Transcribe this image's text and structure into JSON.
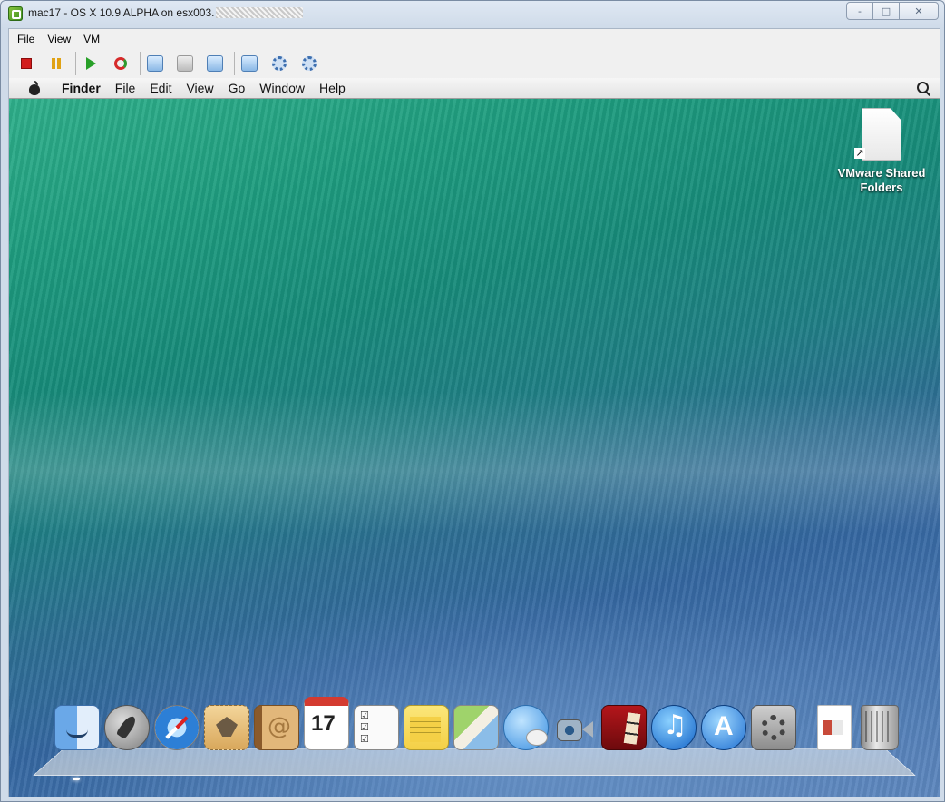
{
  "window": {
    "title": "mac17 - OS X 10.9 ALPHA on esx003.",
    "controls": [
      "-",
      "□",
      "✕"
    ]
  },
  "app_menu": [
    "File",
    "View",
    "VM"
  ],
  "toolbar": {
    "buttons": [
      "stop-icon",
      "pause-icon",
      "play-icon",
      "reset-icon",
      "snapshot-icon",
      "revert-snapshot-icon",
      "snapshot-manager-icon",
      "console-settings-icon",
      "connect-icon",
      "devices-icon"
    ]
  },
  "mac": {
    "menubar": {
      "app": "Finder",
      "items": [
        "File",
        "Edit",
        "View",
        "Go",
        "Window",
        "Help"
      ]
    },
    "desktop_icons": [
      {
        "label": "VMware Shared Folders",
        "arrow": "↗"
      }
    ],
    "dock": [
      "finder-icon",
      "launchpad-icon",
      "safari-icon",
      "mail-icon",
      "contacts-icon",
      "calendar-icon",
      "reminders-icon",
      "notes-icon",
      "maps-icon",
      "messages-icon",
      "facetime-icon",
      "photo-booth-icon",
      "itunes-icon",
      "app-store-icon",
      "system-preferences-icon",
      "document-icon",
      "trash-icon"
    ]
  }
}
